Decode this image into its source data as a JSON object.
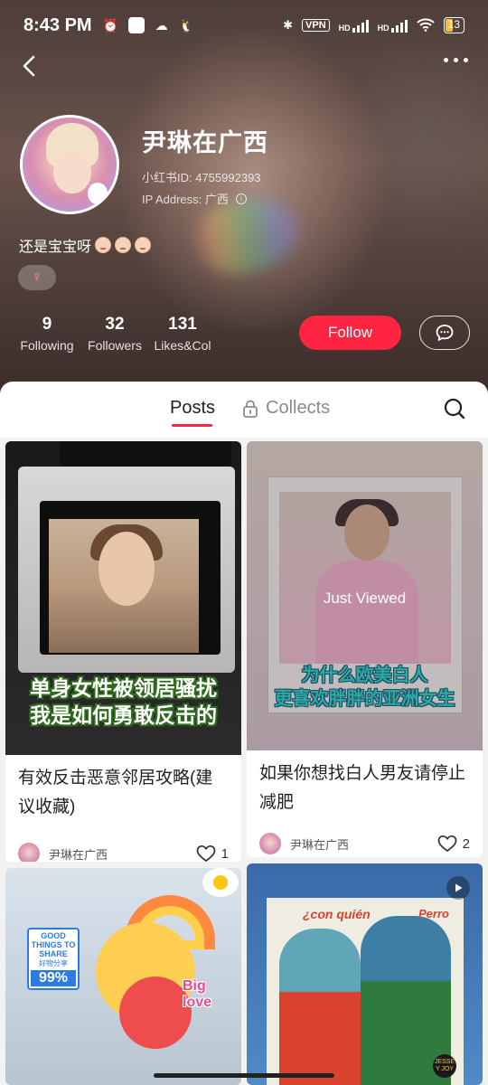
{
  "status_bar": {
    "time": "8:43 PM",
    "vpn": "VPN",
    "network_1": "HD",
    "network_2": "HD",
    "battery": "13"
  },
  "profile": {
    "name": "尹琳在广西",
    "id_text": "小红书ID: 4755992393",
    "ip_text": "IP Address: 广西",
    "bio": "还是宝宝呀",
    "gender_symbol": "♀",
    "stats": [
      {
        "value": "9",
        "label": "Following"
      },
      {
        "value": "32",
        "label": "Followers"
      },
      {
        "value": "131",
        "label": "Likes&Col"
      }
    ],
    "follow_label": "Follow"
  },
  "tabs": {
    "posts": "Posts",
    "collects": "Collects"
  },
  "posts": [
    {
      "cover_caption_line1": "单身女性被领居骚扰",
      "cover_caption_line2": "我是如何勇敢反击的",
      "title": "有效反击恶意邻居攻略(建议收藏)",
      "author": "尹琳在广西",
      "likes": "1"
    },
    {
      "cover_caption_line1": "为什么欧美白人",
      "cover_caption_line2": "更喜欢胖胖的亚洲女生",
      "overlay": "Just Viewed",
      "title": "如果你想找白人男友请停止减肥",
      "author": "尹琳在广西",
      "likes": "2"
    },
    {
      "tag_line1": "GOOD THINGS TO SHARE",
      "tag_line2": "好物分享",
      "tag_percent": "99%",
      "sticker_text_1": "Big",
      "sticker_text_2": "love"
    },
    {
      "poster_text_1": "¿con quién",
      "poster_text_2": "Perro",
      "badge": "JESSE Y JOY"
    }
  ],
  "colors": {
    "accent": "#ff2442"
  }
}
